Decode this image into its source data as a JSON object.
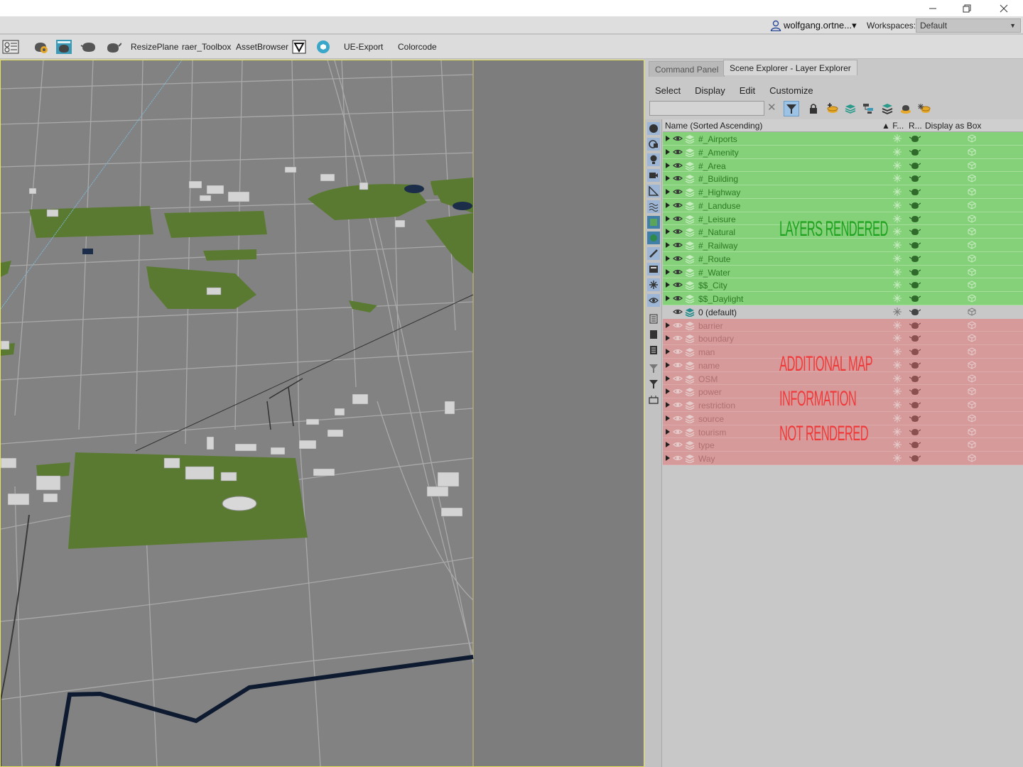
{
  "window": {
    "minimize_icon": "minimize-icon",
    "restore_icon": "restore-icon",
    "close_icon": "close-icon"
  },
  "account": {
    "user": "wolfgang.ortne...▾",
    "workspaces_label": "Workspaces:",
    "workspace_value": "Default"
  },
  "toolbar": {
    "items": [
      "ResizePlane",
      "raer_Toolbox",
      "AssetBrowser",
      "UE-Export",
      "Colorcode"
    ]
  },
  "panel": {
    "tabs": [
      "Command Panel",
      "Scene Explorer - Layer Explorer"
    ],
    "menu": [
      "Select",
      "Display",
      "Edit",
      "Customize"
    ],
    "search_value": "",
    "columns": {
      "name": "Name (Sorted Ascending)",
      "freeze": "▲ F...",
      "render": "R...",
      "display_box": "Display as Box"
    },
    "annotations": {
      "rendered": "LAYERS RENDERED",
      "additional_1": "ADDITIONAL MAP",
      "additional_2": "INFORMATION",
      "additional_3": "NOT RENDERED"
    },
    "rows": [
      {
        "name": "#_Airports",
        "state": "green"
      },
      {
        "name": "#_Amenity",
        "state": "green"
      },
      {
        "name": "#_Area",
        "state": "green"
      },
      {
        "name": "#_Building",
        "state": "green"
      },
      {
        "name": "#_Highway",
        "state": "green"
      },
      {
        "name": "#_Landuse",
        "state": "green"
      },
      {
        "name": "#_Leisure",
        "state": "green"
      },
      {
        "name": "#_Natural",
        "state": "green"
      },
      {
        "name": "#_Railway",
        "state": "green"
      },
      {
        "name": "#_Route",
        "state": "green"
      },
      {
        "name": "#_Water",
        "state": "green"
      },
      {
        "name": "$$_City",
        "state": "green"
      },
      {
        "name": "$$_Daylight",
        "state": "green"
      },
      {
        "name": "0 (default)",
        "state": "grey"
      },
      {
        "name": "barrier",
        "state": "red"
      },
      {
        "name": "boundary",
        "state": "red"
      },
      {
        "name": "man",
        "state": "red"
      },
      {
        "name": "name",
        "state": "red"
      },
      {
        "name": "OSM",
        "state": "red"
      },
      {
        "name": "power",
        "state": "red"
      },
      {
        "name": "restriction",
        "state": "red"
      },
      {
        "name": "source",
        "state": "red"
      },
      {
        "name": "tourism",
        "state": "red"
      },
      {
        "name": "type",
        "state": "red"
      },
      {
        "name": "Way",
        "state": "red"
      }
    ]
  },
  "colors": {
    "rendered_row": "#84d17a",
    "default_row": "#c8c8c8",
    "hidden_row": "#d69a9a",
    "viewport_bg": "#7d7d7d",
    "terrain_green": "#5a7a32",
    "road": "#a8a8a8",
    "active_border": "#e6e25a"
  }
}
